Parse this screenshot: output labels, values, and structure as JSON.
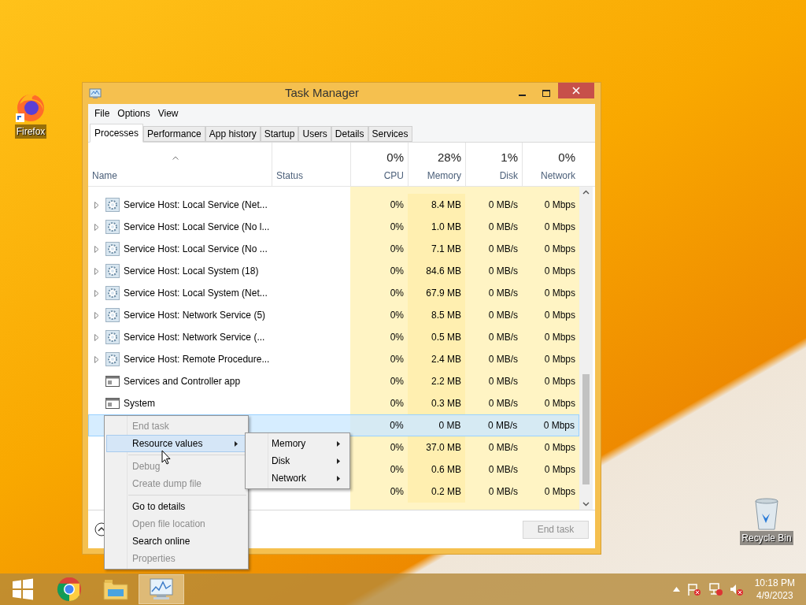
{
  "desktop_icons": [
    {
      "kind": "browser",
      "label": "Firefox"
    },
    {
      "kind": "bin",
      "label": "Recycle Bin"
    }
  ],
  "window": {
    "title": "Task Manager"
  },
  "menu_bar": [
    "File",
    "Options",
    "View"
  ],
  "tabs": [
    {
      "label": "Processes",
      "selected": true
    },
    {
      "label": "Performance",
      "selected": false
    },
    {
      "label": "App history",
      "selected": false
    },
    {
      "label": "Startup",
      "selected": false
    },
    {
      "label": "Users",
      "selected": false
    },
    {
      "label": "Details",
      "selected": false
    },
    {
      "label": "Services",
      "selected": false
    }
  ],
  "columns": [
    {
      "label": "Name"
    },
    {
      "label": "Status"
    },
    {
      "label": "CPU",
      "total": "0%"
    },
    {
      "label": "Memory",
      "total": "28%"
    },
    {
      "label": "Disk",
      "total": "1%"
    },
    {
      "label": "Network",
      "total": "0%"
    }
  ],
  "rows": [
    {
      "kind": "service",
      "name": "Service Host: Local Service (Net...",
      "cpu": "0%",
      "memory": "8.4 MB",
      "disk": "0 MB/s",
      "network": "0 Mbps",
      "selected": false
    },
    {
      "kind": "service",
      "name": "Service Host: Local Service (No l...",
      "cpu": "0%",
      "memory": "1.0 MB",
      "disk": "0 MB/s",
      "network": "0 Mbps",
      "selected": false
    },
    {
      "kind": "service",
      "name": "Service Host: Local Service (No ...",
      "cpu": "0%",
      "memory": "7.1 MB",
      "disk": "0 MB/s",
      "network": "0 Mbps",
      "selected": false
    },
    {
      "kind": "service",
      "name": "Service Host: Local System (18)",
      "cpu": "0%",
      "memory": "84.6 MB",
      "disk": "0 MB/s",
      "network": "0 Mbps",
      "selected": false
    },
    {
      "kind": "service",
      "name": "Service Host: Local System (Net...",
      "cpu": "0%",
      "memory": "67.9 MB",
      "disk": "0 MB/s",
      "network": "0 Mbps",
      "selected": false
    },
    {
      "kind": "service",
      "name": "Service Host: Network Service (5)",
      "cpu": "0%",
      "memory": "8.5 MB",
      "disk": "0 MB/s",
      "network": "0 Mbps",
      "selected": false
    },
    {
      "kind": "service",
      "name": "Service Host: Network Service (...",
      "cpu": "0%",
      "memory": "0.5 MB",
      "disk": "0 MB/s",
      "network": "0 Mbps",
      "selected": false
    },
    {
      "kind": "service",
      "name": "Service Host: Remote Procedure...",
      "cpu": "0%",
      "memory": "2.4 MB",
      "disk": "0 MB/s",
      "network": "0 Mbps",
      "selected": false
    },
    {
      "kind": "app",
      "name": "Services and Controller app",
      "cpu": "0%",
      "memory": "2.2 MB",
      "disk": "0 MB/s",
      "network": "0 Mbps",
      "selected": false
    },
    {
      "kind": "app",
      "name": "System",
      "cpu": "0%",
      "memory": "0.3 MB",
      "disk": "0 MB/s",
      "network": "0 Mbps",
      "selected": false
    },
    {
      "kind": "hidden",
      "cpu": "0%",
      "memory": "0 MB",
      "disk": "0 MB/s",
      "network": "0 Mbps",
      "selected": true
    },
    {
      "kind": "hidden",
      "cpu": "0%",
      "memory": "37.0 MB",
      "disk": "0 MB/s",
      "network": "0 Mbps",
      "selected": false
    },
    {
      "kind": "hidden",
      "cpu": "0%",
      "memory": "0.6 MB",
      "disk": "0 MB/s",
      "network": "0 Mbps",
      "selected": false
    },
    {
      "kind": "hidden",
      "cpu": "0%",
      "memory": "0.2 MB",
      "disk": "0 MB/s",
      "network": "0 Mbps",
      "selected": false
    }
  ],
  "footer": {
    "end_task": "End task",
    "end_task_disabled": true
  },
  "context_menu": [
    {
      "kind": "item",
      "label": "End task",
      "disabled": true,
      "submenu": false,
      "selected": false
    },
    {
      "kind": "item",
      "label": "Resource values",
      "disabled": false,
      "submenu": true,
      "selected": true
    },
    {
      "kind": "separator"
    },
    {
      "kind": "item",
      "label": "Debug",
      "disabled": true,
      "submenu": false,
      "selected": false
    },
    {
      "kind": "item",
      "label": "Create dump file",
      "disabled": true,
      "submenu": false,
      "selected": false
    },
    {
      "kind": "separator"
    },
    {
      "kind": "item",
      "label": "Go to details",
      "disabled": false,
      "submenu": false,
      "selected": false
    },
    {
      "kind": "item",
      "label": "Open file location",
      "disabled": true,
      "submenu": false,
      "selected": false
    },
    {
      "kind": "item",
      "label": "Search online",
      "disabled": false,
      "submenu": false,
      "selected": false
    },
    {
      "kind": "item",
      "label": "Properties",
      "disabled": true,
      "submenu": false,
      "selected": false
    }
  ],
  "submenu": [
    {
      "label": "Memory"
    },
    {
      "label": "Disk"
    },
    {
      "label": "Network"
    }
  ],
  "taskbar": [
    {
      "kind": "start",
      "active": false
    },
    {
      "kind": "chrome",
      "active": false
    },
    {
      "kind": "explorer",
      "active": false
    },
    {
      "kind": "taskmgr",
      "active": true
    }
  ],
  "clock": {
    "time": "10:18 PM",
    "date": "4/9/2023"
  }
}
